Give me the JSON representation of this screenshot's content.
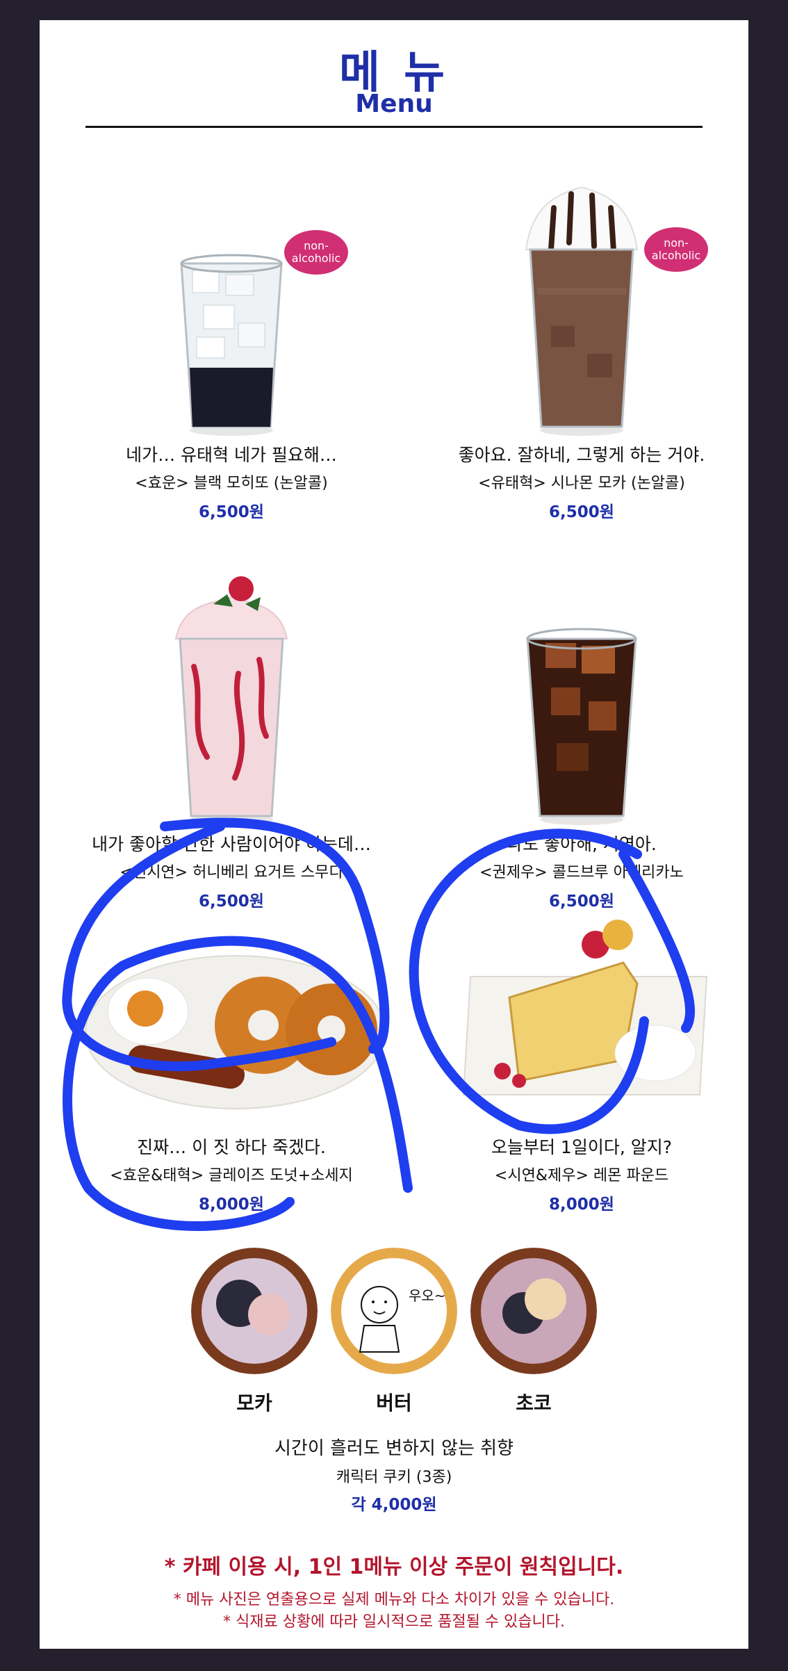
{
  "header": {
    "title_ko": "메 뉴",
    "title_en": "Menu"
  },
  "badge_text": "non-\nalcoholic",
  "items": [
    {
      "tagline": "네가… 유태혁 네가 필요해…",
      "name": "<효운> 블랙 모히또 (논알콜)",
      "price": "6,500원",
      "badge": true
    },
    {
      "tagline": "좋아요. 잘하네, 그렇게 하는 거야.",
      "name": "<유태혁> 시나몬 모카 (논알콜)",
      "price": "6,500원",
      "badge": true
    },
    {
      "tagline": "내가 좋아할 만한 사람이어야 하는데…",
      "name": "<연시연> 허니베리 요거트 스무디",
      "price": "6,500원",
      "badge": false
    },
    {
      "tagline": "나도 좋아해, 시연아.",
      "name": "<권제우> 콜드브루 아메리카노",
      "price": "6,500원",
      "badge": false
    },
    {
      "tagline": "진짜… 이 짓 하다 죽겠다.",
      "name": "<효운&태혁> 글레이즈 도넛+소세지",
      "price": "8,000원",
      "badge": false
    },
    {
      "tagline": "오늘부터 1일이다, 알지?",
      "name": "<시연&제우> 레몬 파운드",
      "price": "8,000원",
      "badge": false
    }
  ],
  "cookies": {
    "labels": [
      "모카",
      "버터",
      "초코"
    ],
    "doodle_text": "우오~",
    "tagline": "시간이 흘러도 변하지 않는 취향",
    "name": "캐릭터 쿠키 (3종)",
    "price": "각 4,000원"
  },
  "notices": {
    "main": "* 카페 이용 시, 1인 1메뉴 이상 주문이 원칙입니다.",
    "line1": "* 메뉴 사진은 연출용으로 실제 메뉴와 다소 차이가 있을 수 있습니다.",
    "line2": "* 식재료 상황에 따라 일시적으로 품절될 수 있습니다."
  },
  "colors": {
    "accent_blue": "#1f2fa8",
    "badge_pink": "#d12f73",
    "notice_red": "#b3152c",
    "marker_blue": "#1f3ef0",
    "frame_bg": "#25202d"
  }
}
